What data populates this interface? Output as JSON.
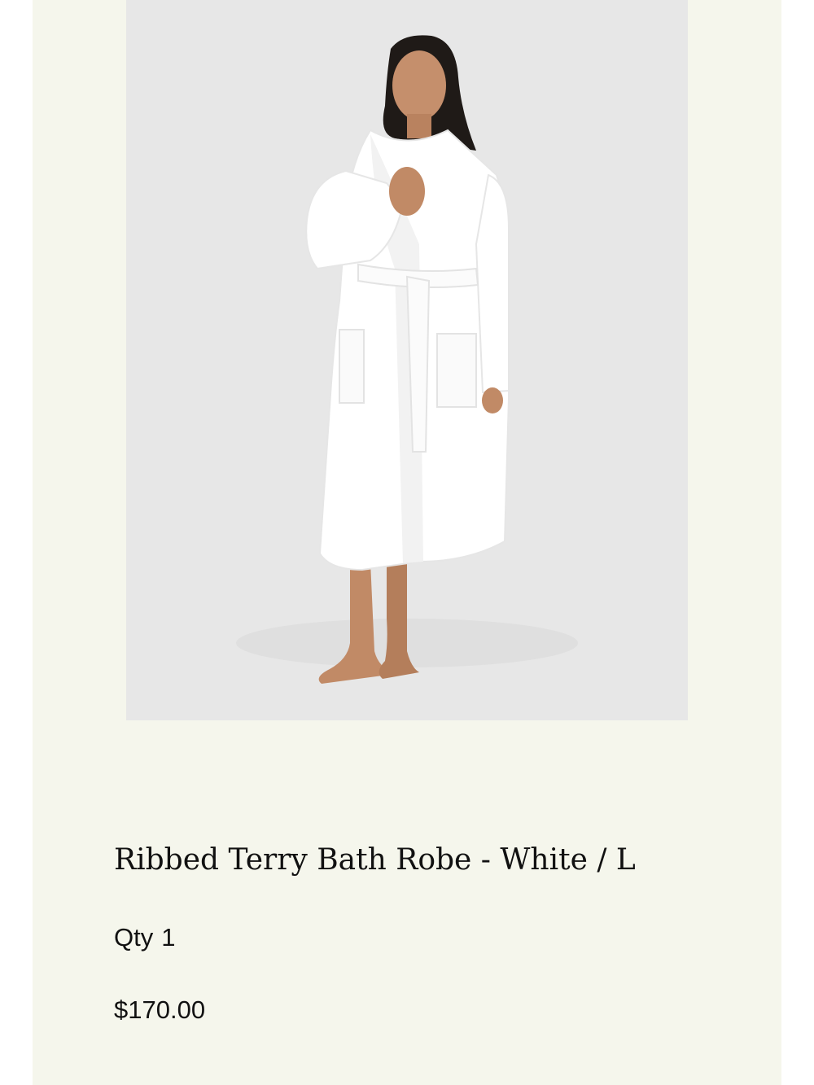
{
  "product": {
    "image_subject": "model-wearing-white-ribbed-robe",
    "title": "Ribbed Terry Bath Robe - White / L",
    "qty_label": "Qty",
    "qty_value": "1",
    "price": "$170.00"
  },
  "colors": {
    "page_background": "#f5f6ec",
    "image_background": "#e7e7e7",
    "text": "#111111"
  }
}
